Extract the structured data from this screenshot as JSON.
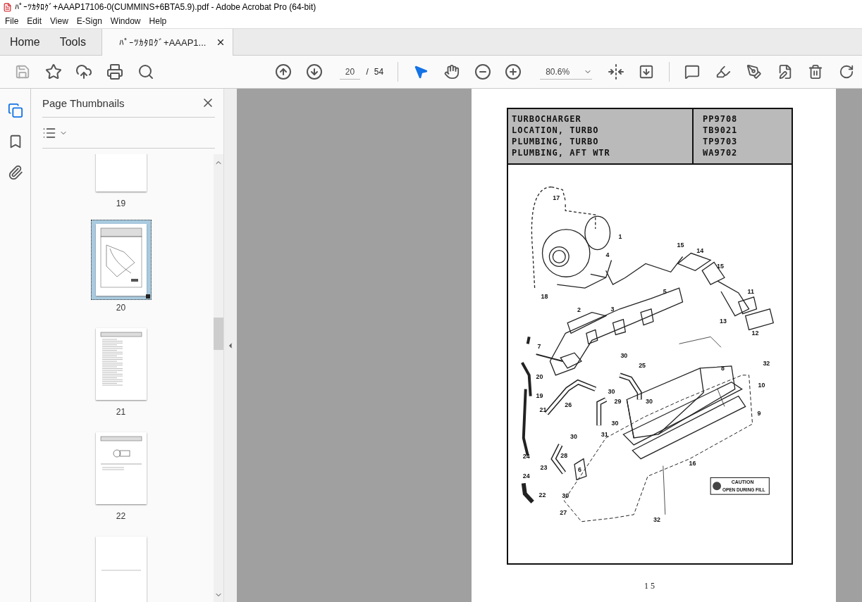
{
  "window": {
    "title": "ﾊﾟｰﾂｶﾀﾛｸﾞ+AAAP17106-0(CUMMINS+6BTA5.9).pdf - Adobe Acrobat Pro (64-bit)"
  },
  "menu": [
    "File",
    "Edit",
    "View",
    "E-Sign",
    "Window",
    "Help"
  ],
  "tabs": [
    {
      "label": "Home",
      "kind": "nav",
      "selected": false
    },
    {
      "label": "Tools",
      "kind": "nav",
      "selected": false
    },
    {
      "label": "ﾊﾟｰﾂｶﾀﾛｸﾞ+AAAP1...",
      "kind": "document",
      "selected": true
    }
  ],
  "toolbar": {
    "page": {
      "current": "20",
      "separator": "/",
      "total": "54"
    },
    "zoom": "80.6%",
    "tools": [
      {
        "kind": "select",
        "selected": true
      },
      {
        "kind": "hand",
        "selected": false
      }
    ]
  },
  "rail": [
    {
      "kind": "pages",
      "selected": true
    },
    {
      "kind": "bookmarks",
      "selected": false
    },
    {
      "kind": "attachments",
      "selected": false
    }
  ],
  "panel": {
    "title": "Page Thumbnails",
    "thumbnails": [
      {
        "kind": "blank",
        "label": "19",
        "selected": false
      },
      {
        "kind": "diagram",
        "label": "20",
        "selected": true
      },
      {
        "kind": "list",
        "label": "21",
        "selected": false
      },
      {
        "kind": "part",
        "label": "22",
        "selected": false
      },
      {
        "kind": "blank",
        "selected": false
      }
    ]
  },
  "document": {
    "header": [
      {
        "title": "TURBOCHARGER",
        "code": "PP9708"
      },
      {
        "title": "LOCATION, TURBO",
        "code": "TB9021"
      },
      {
        "title": "PLUMBING, TURBO",
        "code": "TP9703"
      },
      {
        "title": "PLUMBING, AFT WTR",
        "code": "WA9702"
      }
    ],
    "callouts": [
      "17",
      "1",
      "15",
      "14",
      "15",
      "4",
      "11",
      "18",
      "5",
      "2",
      "3",
      "13",
      "12",
      "7",
      "30",
      "25",
      "32",
      "8",
      "20",
      "10",
      "30",
      "19",
      "26",
      "29",
      "30",
      "21",
      "9",
      "30",
      "31",
      "30",
      "28",
      "24",
      "23",
      "16",
      "6",
      "24",
      "22",
      "30",
      "27",
      "32"
    ],
    "caution": {
      "title": "CAUTION",
      "text": "OPEN DURING FILL"
    },
    "page_number": "15"
  }
}
